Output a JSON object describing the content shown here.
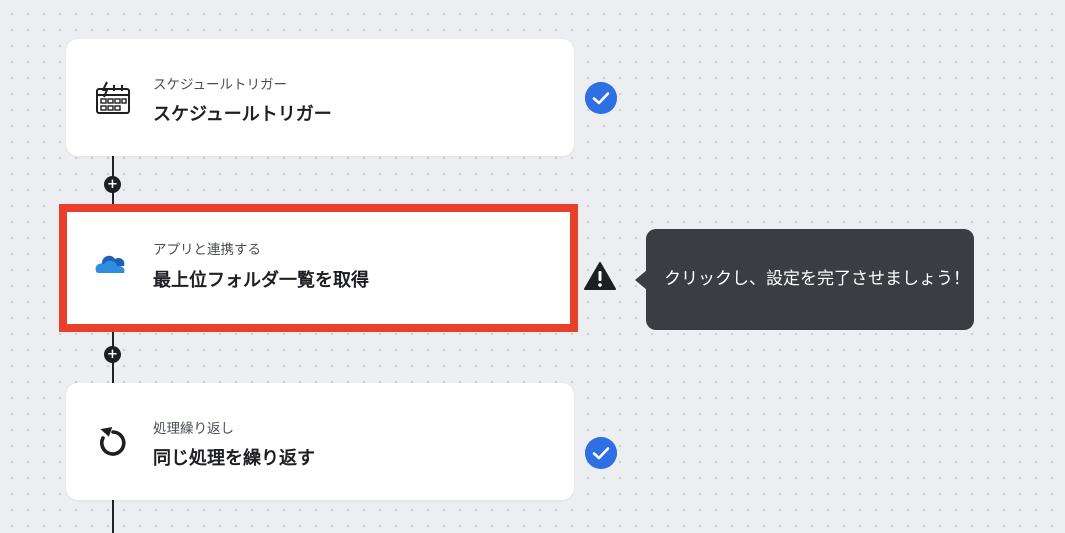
{
  "flow": {
    "steps": [
      {
        "subtitle": "スケジュールトリガー",
        "title": "スケジュールトリガー",
        "icon": "schedule-calendar-icon",
        "status": "complete"
      },
      {
        "subtitle": "アプリと連携する",
        "title": "最上位フォルダ一覧を取得",
        "icon": "onedrive-cloud-icon",
        "status": "warning"
      },
      {
        "subtitle": "処理繰り返し",
        "title": "同じ処理を繰り返す",
        "icon": "loop-repeat-icon",
        "status": "complete"
      }
    ],
    "add_symbol": "+"
  },
  "tooltip": {
    "text": "クリックし、設定を完了させましょう！"
  },
  "colors": {
    "highlight_border": "#e8402a",
    "check_badge": "#2f6fe4",
    "tooltip_bg": "#3b3d42",
    "onedrive_dark": "#1e5fb8",
    "onedrive_light": "#2e8fe0"
  }
}
